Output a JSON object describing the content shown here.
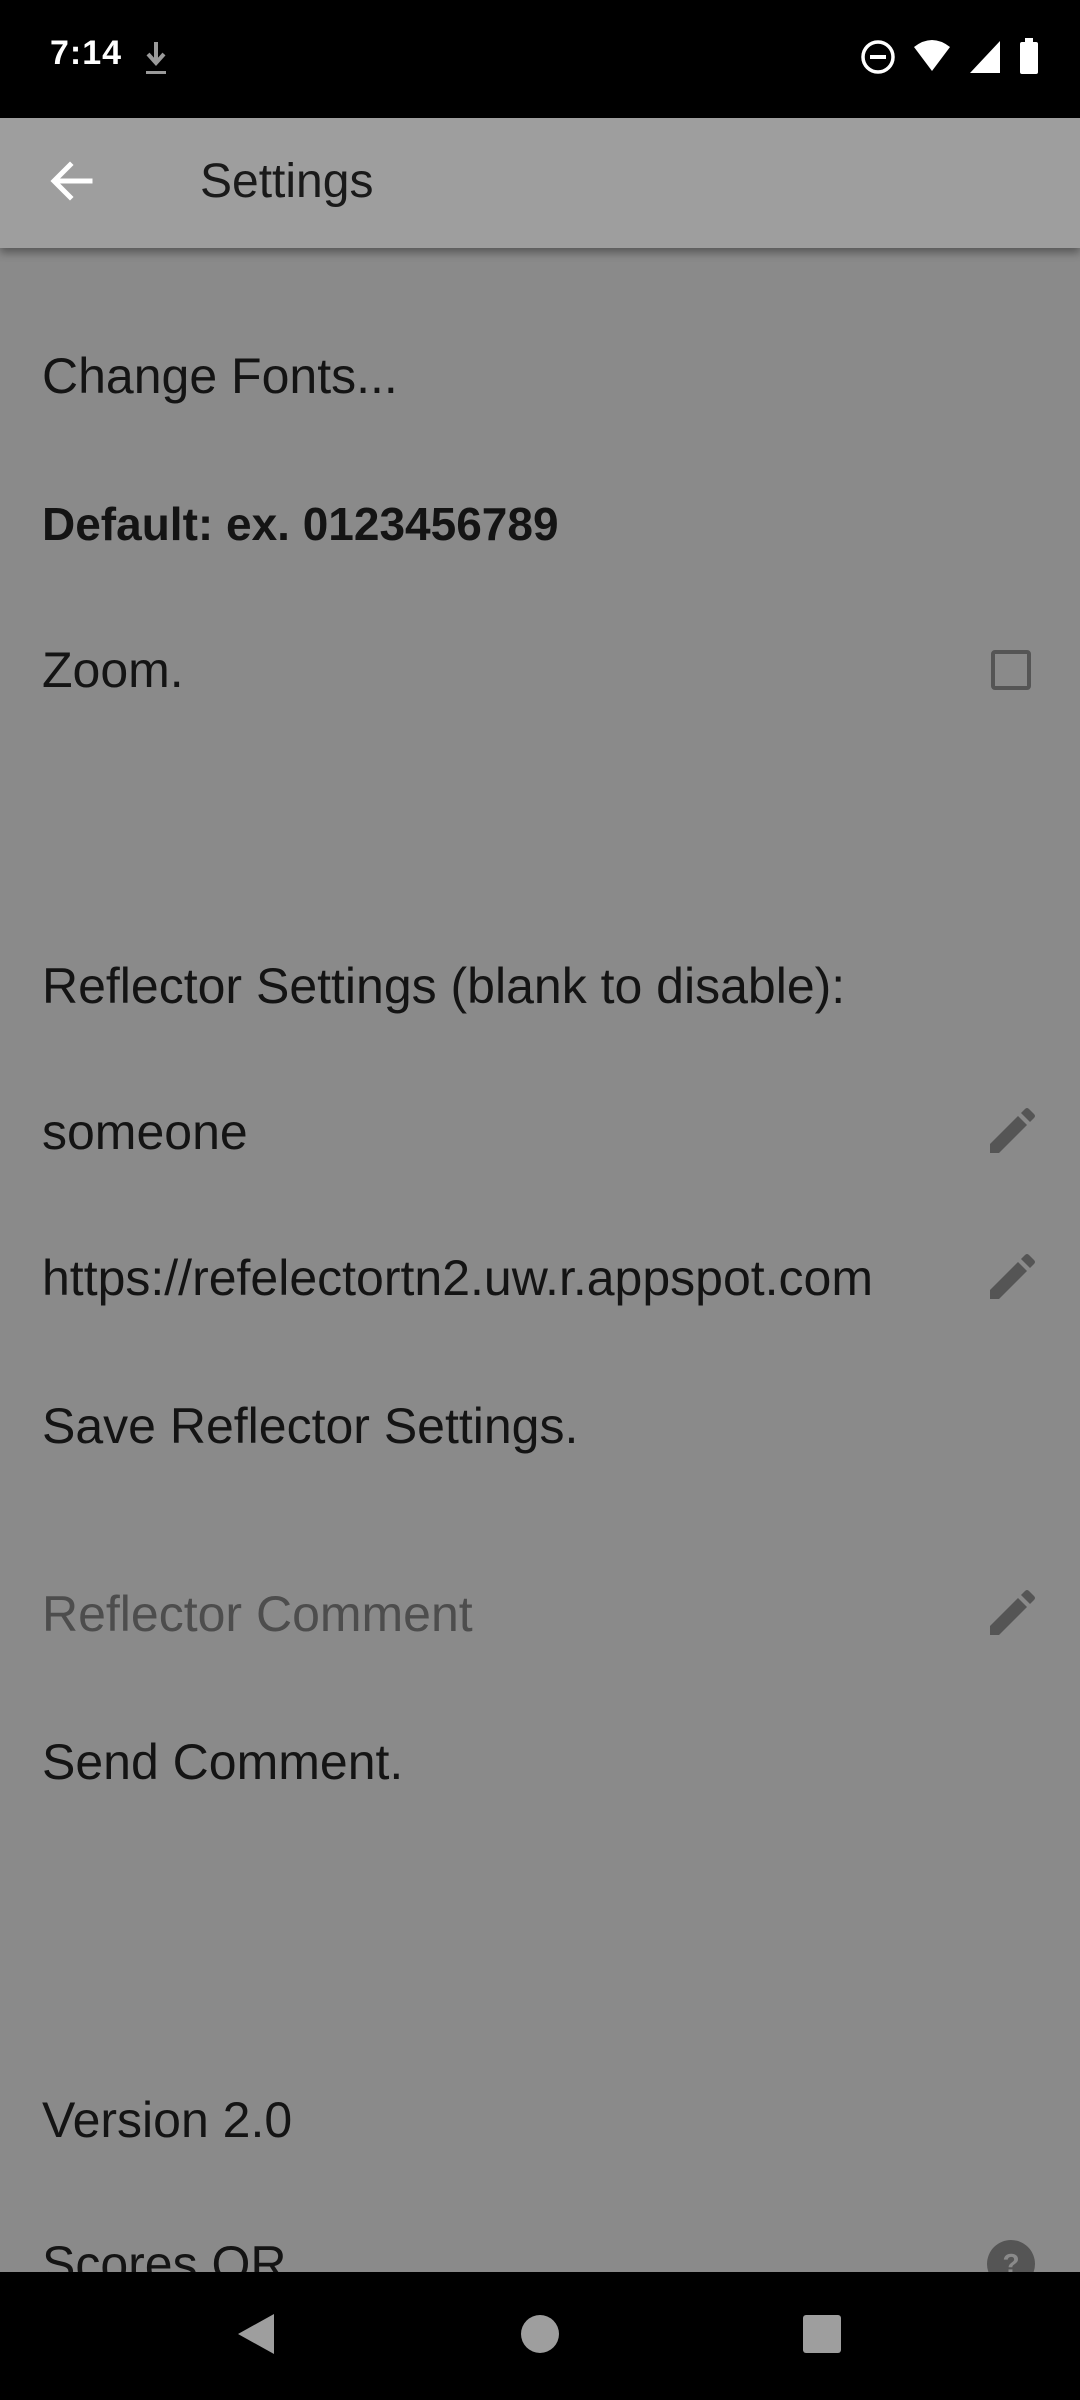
{
  "status_bar": {
    "time": "7:14"
  },
  "app_bar": {
    "title": "Settings"
  },
  "settings": {
    "change_fonts": "Change Fonts...",
    "font_default": "Default: ex. 0123456789",
    "zoom_label": "Zoom.",
    "zoom_checked": false,
    "reflector_header": "Reflector Settings (blank to disable):",
    "reflector_user": "someone",
    "reflector_url": "https://refelectortn2.uw.r.appspot.com",
    "save_reflector": "Save Reflector Settings.",
    "comment_placeholder": "Reflector Comment",
    "send_comment": "Send Comment.",
    "version": "Version 2.0",
    "scores_qr": "Scores QR"
  },
  "icons": {
    "back": "arrow-back-icon",
    "edit": "pencil-icon",
    "help": "help-circle-icon"
  }
}
